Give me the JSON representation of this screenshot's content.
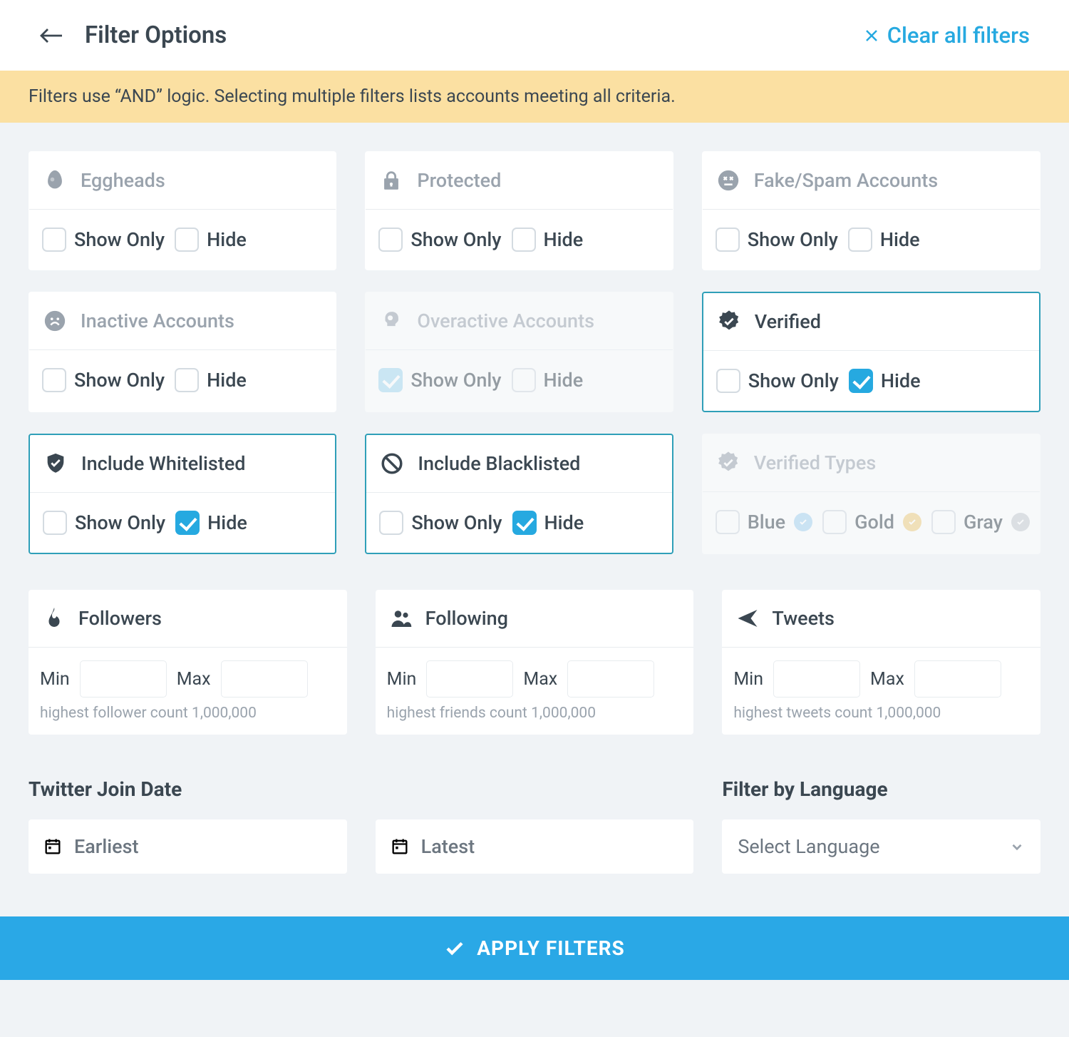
{
  "header": {
    "title": "Filter Options",
    "clear": "Clear all filters"
  },
  "banner": "Filters use “AND” logic. Selecting multiple filters lists accounts meeting all criteria.",
  "labels": {
    "show_only": "Show Only",
    "hide": "Hide",
    "min": "Min",
    "max": "Max"
  },
  "cards": {
    "eggheads": {
      "title": "Eggheads",
      "show_only": false,
      "hide": false,
      "active": false,
      "disabled": false
    },
    "protected": {
      "title": "Protected",
      "show_only": false,
      "hide": false,
      "active": false,
      "disabled": false
    },
    "fake": {
      "title": "Fake/Spam Accounts",
      "show_only": false,
      "hide": false,
      "active": false,
      "disabled": false
    },
    "inactive": {
      "title": "Inactive Accounts",
      "show_only": false,
      "hide": false,
      "active": false,
      "disabled": false
    },
    "overactive": {
      "title": "Overactive Accounts",
      "show_only": true,
      "hide": false,
      "active": false,
      "disabled": true,
      "faded": true
    },
    "verified": {
      "title": "Verified",
      "show_only": false,
      "hide": true,
      "active": true,
      "disabled": false
    },
    "whitelisted": {
      "title": "Include Whitelisted",
      "show_only": false,
      "hide": true,
      "active": true,
      "disabled": false
    },
    "blacklisted": {
      "title": "Include Blacklisted",
      "show_only": false,
      "hide": true,
      "active": true,
      "disabled": false
    },
    "verified_types": {
      "title": "Verified Types",
      "disabled": true,
      "options": [
        {
          "label": "Blue",
          "color": "#a6d4f2",
          "checked": false
        },
        {
          "label": "Gold",
          "color": "#f0ce7d",
          "checked": false
        },
        {
          "label": "Gray",
          "color": "#c7ccd1",
          "checked": false
        }
      ]
    }
  },
  "ranges": {
    "followers": {
      "title": "Followers",
      "note": "highest follower count 1,000,000",
      "min": "",
      "max": ""
    },
    "following": {
      "title": "Following",
      "note": "highest friends count 1,000,000",
      "min": "",
      "max": ""
    },
    "tweets": {
      "title": "Tweets",
      "note": "highest tweets count 1,000,000",
      "min": "",
      "max": ""
    }
  },
  "join_date": {
    "title": "Twitter Join Date",
    "earliest": "Earliest",
    "latest": "Latest"
  },
  "language": {
    "title": "Filter by Language",
    "placeholder": "Select Language"
  },
  "apply": "APPLY FILTERS"
}
